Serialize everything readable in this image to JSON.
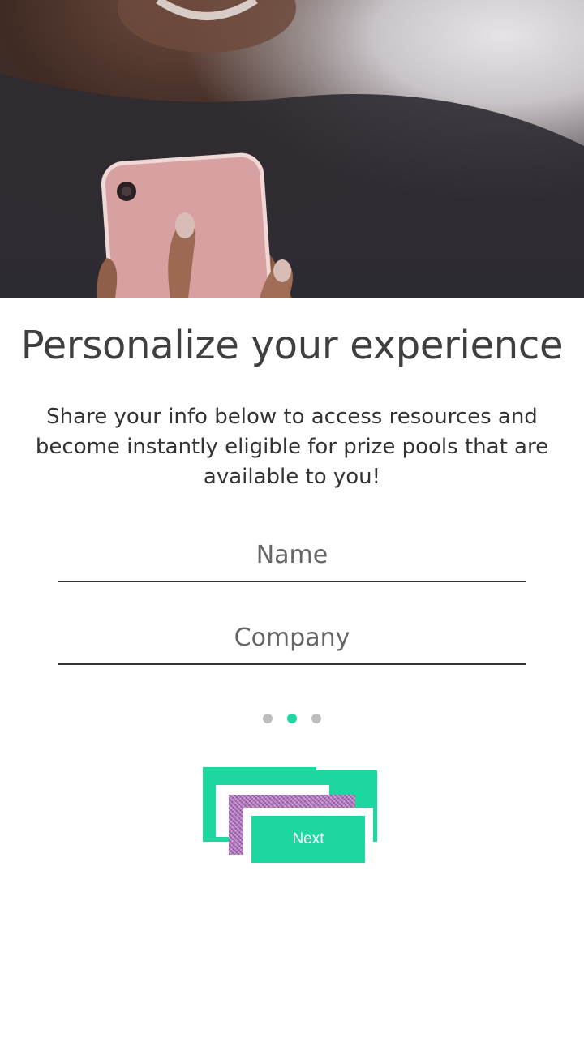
{
  "hero": {
    "image_label": "woman-holding-phone-photo"
  },
  "content": {
    "title": "Personalize your experience",
    "subtitle": "Share your info below to access resources and become instantly eligible for prize pools that are available to you!"
  },
  "form": {
    "name_placeholder": "Name",
    "name_value": "",
    "company_placeholder": "Company",
    "company_value": ""
  },
  "pager": {
    "total": 3,
    "active_index": 1
  },
  "actions": {
    "next_label": "Next"
  },
  "colors": {
    "accent": "#1ed6a0",
    "text": "#333333",
    "dot_inactive": "#bdbdbd"
  }
}
